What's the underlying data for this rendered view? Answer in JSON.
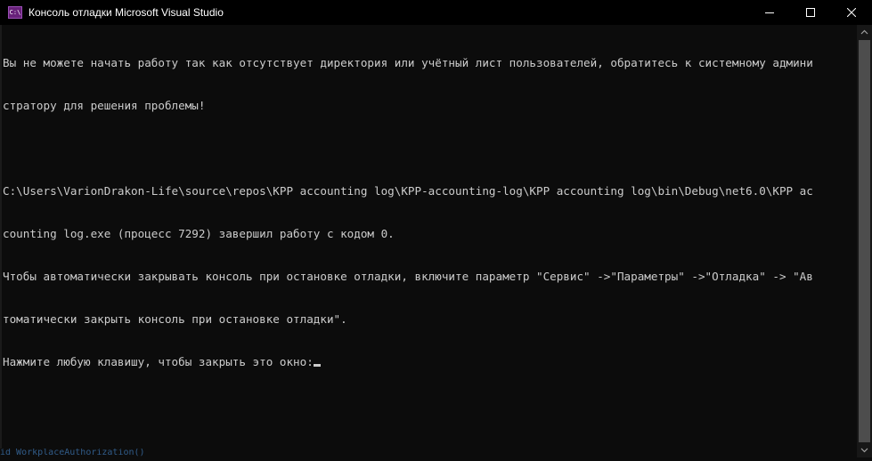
{
  "window": {
    "title": "Консоль отладки Microsoft Visual Studio",
    "icon_label": "C:\\",
    "controls": {
      "minimize": "minimize-icon",
      "maximize": "maximize-icon",
      "close": "close-icon"
    }
  },
  "console": {
    "lines": [
      "Вы не можете начать работу так как отсутствует директория или учётный лист пользователей, обратитесь к системному админи",
      "стратору для решения проблемы!",
      "",
      "C:\\Users\\VarionDrakon-Life\\source\\repos\\KPP accounting log\\KPP-accounting-log\\KPP accounting log\\bin\\Debug\\net6.0\\KPP ac",
      "counting log.exe (процесс 7292) завершил работу с кодом 0.",
      "Чтобы автоматически закрывать консоль при остановке отладки, включите параметр \"Сервис\" ->\"Параметры\" ->\"Отладка\" -> \"Ав",
      "томатически закрыть консоль при остановке отладки\".",
      "Нажмите любую клавишу, чтобы закрыть это окно:"
    ]
  },
  "background": {
    "code_snippet": "id WorkplaceAuthorization()"
  },
  "colors": {
    "console_bg": "#0c0c0c",
    "console_text": "#cccccc",
    "titlebar_bg": "#000000",
    "scrollbar_thumb": "#4d4d4d"
  }
}
